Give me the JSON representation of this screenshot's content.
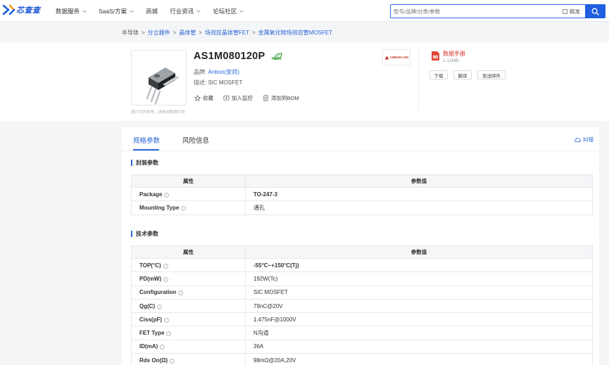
{
  "brand": {
    "logo_text": "芯查查",
    "accent": "#1f5fe0",
    "link_color": "#2a66d9"
  },
  "nav": {
    "items": [
      {
        "label": "数据服务",
        "has_dropdown": true
      },
      {
        "label": "SaaS/方案",
        "has_dropdown": true
      },
      {
        "label": "商城",
        "has_dropdown": false
      },
      {
        "label": "行业资讯",
        "has_dropdown": true
      },
      {
        "label": "论坛社区",
        "has_dropdown": true
      }
    ]
  },
  "search": {
    "placeholder": "型号/品牌/分类/参数",
    "value": "",
    "exact_label": "精准",
    "exact_checked": false
  },
  "breadcrumb": {
    "items": [
      "半导体",
      "分立器件",
      "晶体管",
      "场效应晶体管FET",
      "金属氧化物场效应管MOSFET"
    ]
  },
  "product": {
    "part_number": "AS1M080120P",
    "rohs_label": "RoHS",
    "brand_label": "品牌:",
    "brand_value": "Anbon(安邦)",
    "desc_label": "描述:",
    "desc_value": "SIC MOSFET",
    "image_note": "图片仅供参考，请参阅数据手册",
    "brand_logo_text": "ANBON LED",
    "actions": {
      "favorite": "收藏",
      "monitor": "加入监控",
      "bom": "添加到BOM"
    }
  },
  "datasheet": {
    "title": "数据手册",
    "size": "1.12MB",
    "download": "下载",
    "translate": "翻译",
    "send": "发送邮件"
  },
  "tabs": {
    "spec": "规格参数",
    "risk": "风险信息",
    "correct": "纠错"
  },
  "package_section": {
    "title": "封装参数",
    "header_attr": "属性",
    "header_value": "参数值",
    "rows": [
      {
        "name": "Package",
        "value": "TO-247-3",
        "bold": true
      },
      {
        "name": "Mounting Type",
        "value": "通孔",
        "bold": false
      }
    ]
  },
  "tech_section": {
    "title": "技术参数",
    "header_attr": "属性",
    "header_value": "参数值",
    "rows": [
      {
        "name": "TOP(°C)",
        "value": "-55°C~+150°C(Tj)",
        "bold": true
      },
      {
        "name": "PD(mW)",
        "value": "192W(Tc)",
        "bold": false
      },
      {
        "name": "Configuration",
        "value": "SIC MOSFET",
        "bold": false
      },
      {
        "name": "Qg(C)",
        "value": "79nC@20V",
        "bold": false
      },
      {
        "name": "Ciss(pF)",
        "value": "1.475nF@1000V",
        "bold": false
      },
      {
        "name": "FET Type",
        "value": "N沟道",
        "bold": false
      },
      {
        "name": "ID(mA)",
        "value": "36A",
        "bold": false
      },
      {
        "name": "Rds On(Ω)",
        "value": "98mΩ@20A,20V",
        "bold": false
      }
    ]
  }
}
